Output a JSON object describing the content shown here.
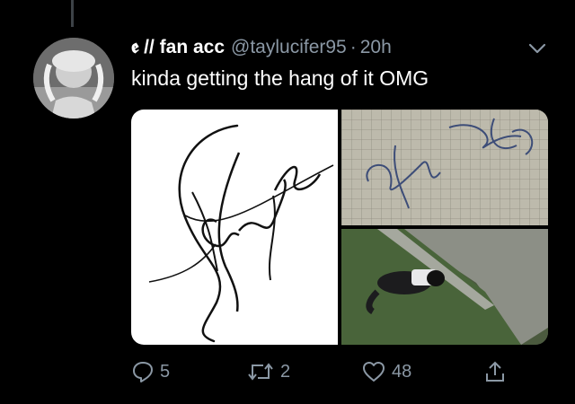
{
  "tweet": {
    "display_name": "𝖊 // fan acc",
    "handle": "@taylucifer95",
    "separator": "·",
    "time": "20h",
    "text": "kinda getting the hang of it OMG"
  },
  "actions": {
    "reply_count": "5",
    "retweet_count": "2",
    "like_count": "48"
  },
  "icons": [
    "chevron-down-icon",
    "reply-icon",
    "retweet-icon",
    "like-icon",
    "share-icon"
  ],
  "colors": {
    "background": "#000000",
    "primary_text": "#ffffff",
    "secondary_text": "#8b98a5",
    "thread_line": "#3d4247"
  }
}
